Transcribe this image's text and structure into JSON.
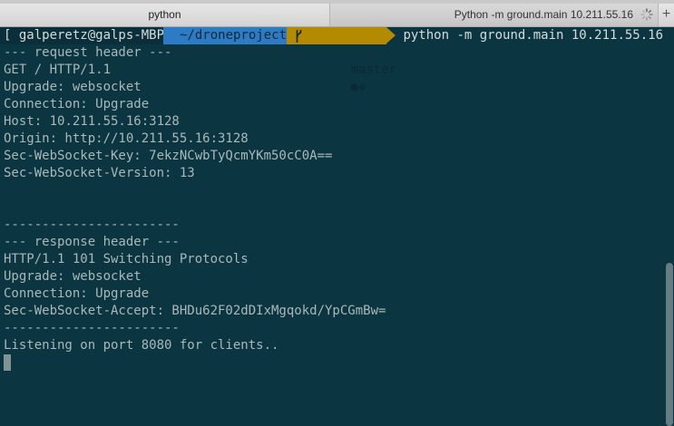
{
  "window": {
    "tabs": [
      {
        "label": "python"
      },
      {
        "label": "Python -m ground.main 10.211.55.16"
      }
    ],
    "new_tab_label": "+"
  },
  "prompt": {
    "user": "[ galperetz@galps-MBP",
    "dir": "~/droneproject",
    "branch_icon": "git-branch-icon",
    "branch": "master",
    "status": "●✚",
    "command": "python -m ground.main 10.211.55.16"
  },
  "output": {
    "lines": [
      "--- request header ---",
      "GET / HTTP/1.1",
      "Upgrade: websocket",
      "Connection: Upgrade",
      "Host: 10.211.55.16:3128",
      "Origin: http://10.211.55.16:3128",
      "Sec-WebSocket-Key: 7ekzNCwbTyQcmYKm50cC0A==",
      "Sec-WebSocket-Version: 13",
      "",
      "",
      "-----------------------",
      "--- response header ---",
      "HTTP/1.1 101 Switching Protocols",
      "Upgrade: websocket",
      "Connection: Upgrade",
      "Sec-WebSocket-Accept: BHDu62F02dDIxMgqokd/YpCGmBw=",
      "-----------------------",
      "Listening on port 8080 for clients.."
    ]
  },
  "colors": {
    "background": "#0b3541",
    "text": "#aab8b9",
    "dir_segment": "#2e7bc5",
    "git_segment": "#b38a00"
  }
}
